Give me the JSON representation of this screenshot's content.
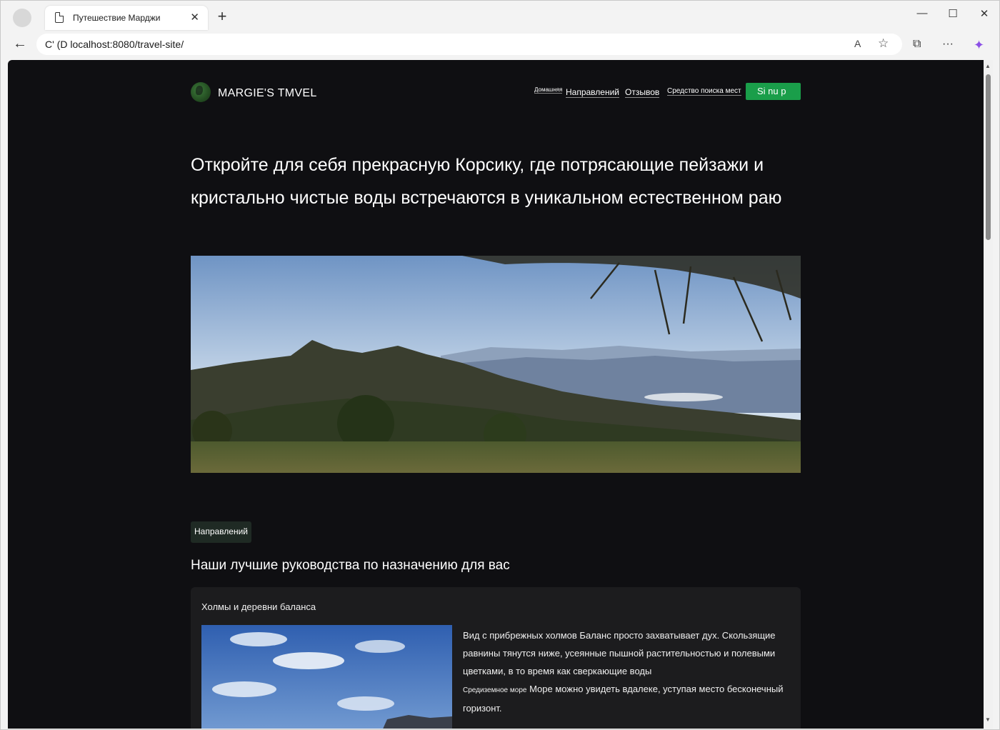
{
  "browser": {
    "tab_title": "Путешествие Марджи",
    "tab_close": "✕",
    "new_tab": "+",
    "url_prefix": "C' (D",
    "url": "localhost:8080/travel-site/",
    "window_controls": {
      "minimize": "—",
      "maximize": "☐",
      "close": "✕"
    },
    "icons": {
      "back": "←",
      "read_aloud": "A",
      "favorite": "☆",
      "collections": "⧉",
      "more": "···",
      "copilot": "✦"
    }
  },
  "site": {
    "logo_text": "MARGIE'S TMVEL",
    "nav": {
      "home": "Домашняя",
      "destinations": "Направлений",
      "reviews": "Отзывов",
      "finder": "Средство поиска мест",
      "signup": "Si nu   p"
    },
    "hero_title": "Откройте для себя прекрасную Корсику, где потрясающие пейзажи и кристально чистые воды встречаются в уникальном естественном раю",
    "section_pill": "Направлений",
    "section_title": "Наши лучшие руководства по назначению для вас",
    "card": {
      "title": "Холмы и деревни баланса",
      "text_1": "Вид с прибрежных холмов Баланс просто захватывает дух. Скользящие равнины тянутся ниже, усеянные пышной растительностью и полевыми цветками, в то время как сверкающие воды",
      "text_small": "Средиземное море",
      "text_2": "Море можно увидеть вдалеке, уступая место бесконечный горизонт."
    }
  },
  "colors": {
    "page_bg": "#0f0f12",
    "accent_green": "#1a9e4a",
    "card_bg": "#1c1c1e"
  }
}
